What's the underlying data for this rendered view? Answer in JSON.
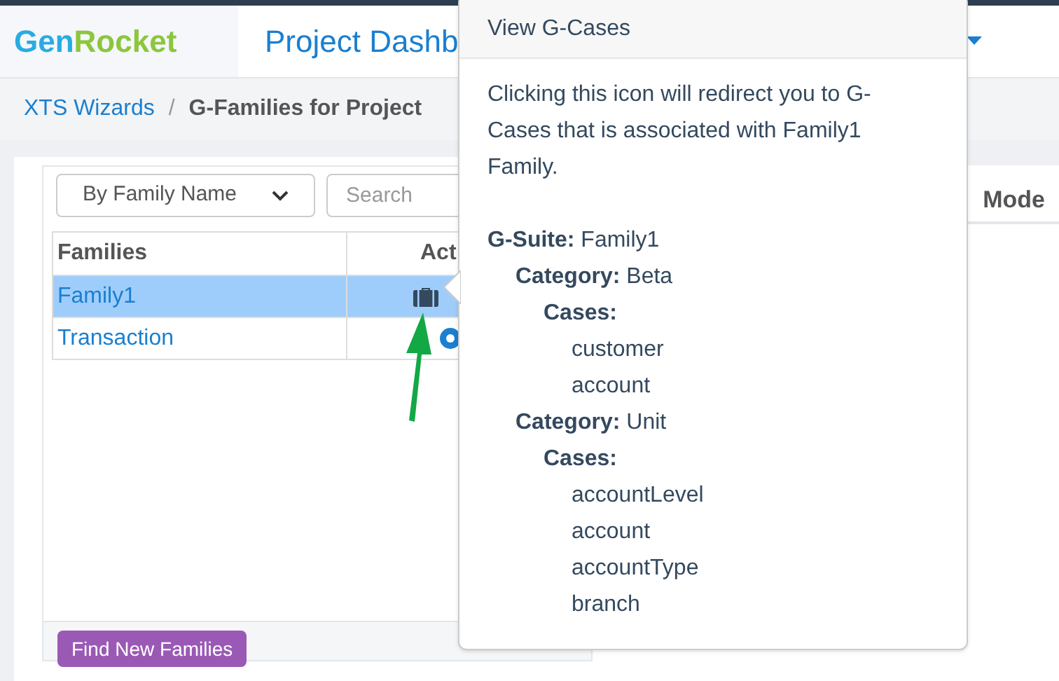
{
  "header": {
    "logo": {
      "first": "Gen",
      "second": "Rocket"
    },
    "title": "Project Dashb"
  },
  "breadcrumb": [
    {
      "label": "XTS Wizards",
      "kind": "link"
    },
    {
      "label": "/",
      "kind": "separator"
    },
    {
      "label": "G-Families for Project",
      "kind": "current"
    }
  ],
  "filter": {
    "select": "By Family Name",
    "search_placeholder": "Search"
  },
  "mode_label": "Mode",
  "table": {
    "columns": [
      "Families",
      "Act"
    ],
    "rows": [
      {
        "name": "Family1",
        "selected": true,
        "kind": "briefcase"
      },
      {
        "name": "Transaction",
        "selected": false,
        "kind": "circle"
      }
    ]
  },
  "find_button": "Find New Families",
  "popover": {
    "title": "View G-Cases",
    "description": "Clicking this icon will redirect you to G-Cases that is associated with Family1 Family.",
    "tree": [
      {
        "label": "G-Suite:",
        "value": "Family1",
        "children": [
          {
            "label": "Category:",
            "value": "Beta",
            "children": [
              {
                "label": "Cases:",
                "children": [
                  {
                    "value": "customer"
                  },
                  {
                    "value": "account"
                  }
                ]
              }
            ]
          },
          {
            "label": "Category:",
            "value": "Unit",
            "children": [
              {
                "label": "Cases:",
                "children": [
                  {
                    "value": "accountLevel"
                  },
                  {
                    "value": "account"
                  },
                  {
                    "value": "accountType"
                  },
                  {
                    "value": "branch"
                  }
                ]
              }
            ]
          }
        ]
      }
    ]
  }
}
